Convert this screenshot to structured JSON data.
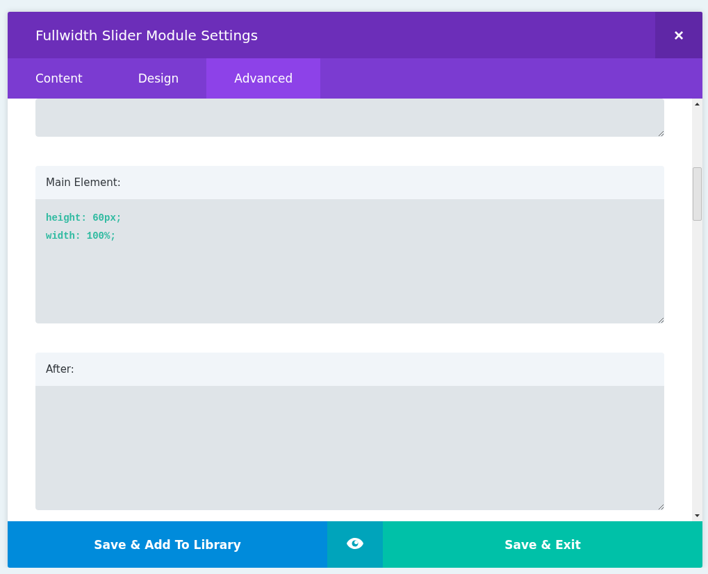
{
  "window": {
    "title": "Fullwidth Slider Module Settings",
    "close": "×"
  },
  "tabs": [
    {
      "label": "Content",
      "selected": false
    },
    {
      "label": "Design",
      "selected": false
    },
    {
      "label": "Advanced",
      "selected": true
    }
  ],
  "fields": [
    {
      "kind": "code"
    },
    {
      "kind": "code",
      "label": "Main Element:",
      "value": "height: 60px;\nwidth: 100%;"
    },
    {
      "kind": "code",
      "label": "After:"
    }
  ],
  "footer": {
    "library_button": "Save & Add To Library",
    "exit_button": "Save & Exit"
  }
}
